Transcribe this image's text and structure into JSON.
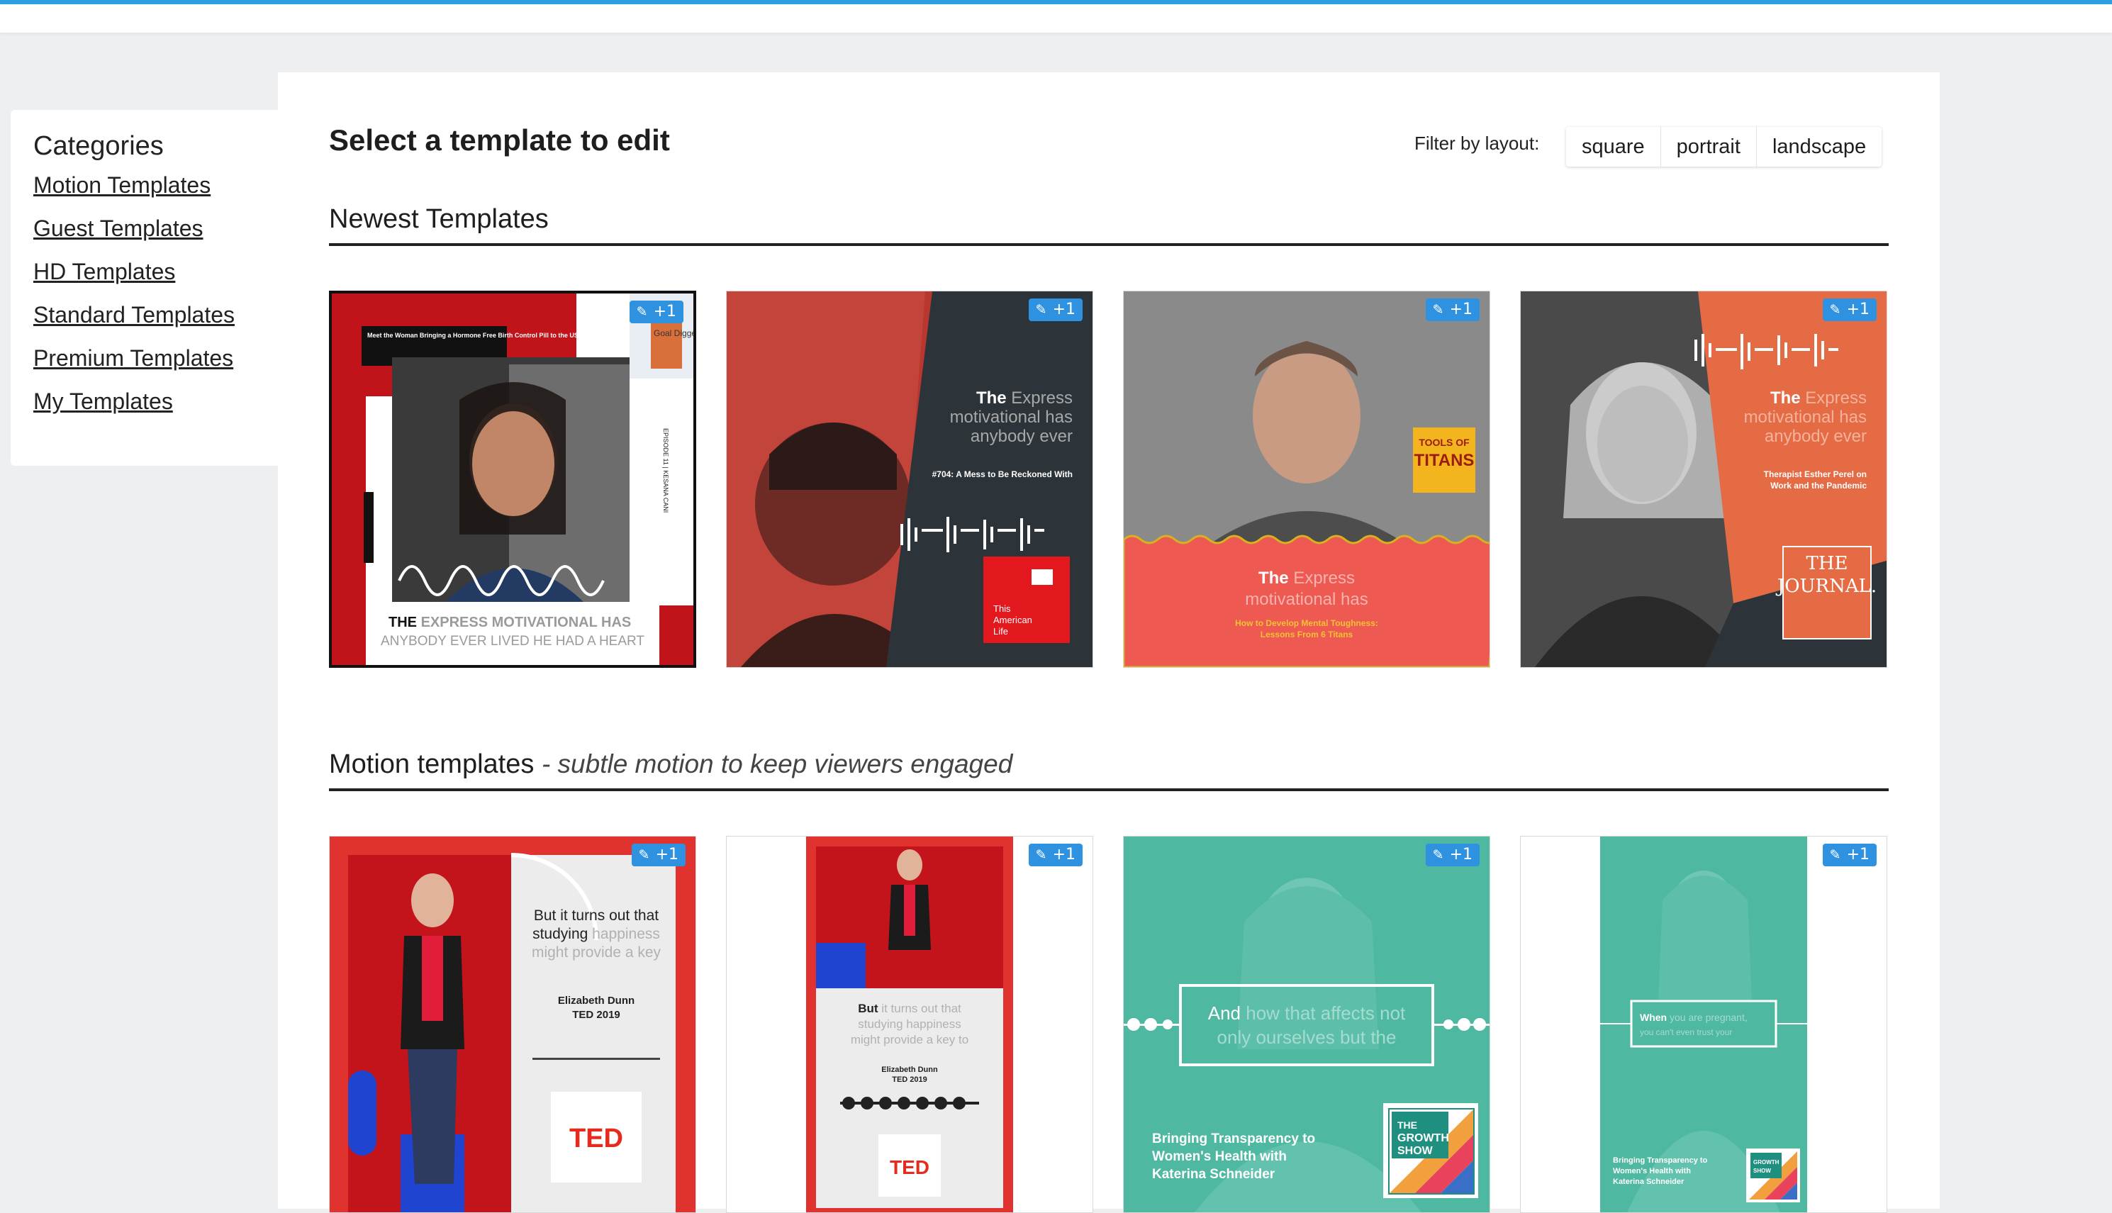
{
  "sidebar": {
    "heading": "Categories",
    "links": [
      "Motion Templates",
      "Guest Templates",
      "HD Templates",
      "Standard Templates",
      "Premium Templates",
      "My Templates"
    ]
  },
  "header": {
    "title": "Select a template to edit",
    "filter_label": "Filter by layout:",
    "filters": [
      "square",
      "portrait",
      "landscape"
    ]
  },
  "sections": {
    "newest": {
      "title": "Newest Templates"
    },
    "motion": {
      "title": "Motion templates",
      "subtitle": "- subtle motion to keep viewers engaged"
    }
  },
  "badge_label": "+1",
  "cards": {
    "c1": {
      "top_text": "Meet the Woman Bringing a Hormone Free Birth Control Pill to the US Market",
      "logo_text": "Goal Digger",
      "side_text": "EPISODE 11 | KESANA CANI",
      "caption_bold": "THE",
      "caption_rest": "EXPRESS MOTIVATIONAL HAS",
      "caption_line2": "ANYBODY EVER LIVED HE HAD A HEART"
    },
    "c2": {
      "headline_bold": "The",
      "headline_rest": "Express",
      "line2": "motivational has",
      "line3": "anybody ever",
      "episode": "#704: A Mess to Be Reckoned With",
      "logo_line1": "This",
      "logo_line2": "American",
      "logo_line3": "Life"
    },
    "c3": {
      "logo_line1": "TOOLS OF",
      "logo_line2": "TITANS",
      "headline_bold": "The",
      "headline_rest": "Express",
      "line2": "motivational has",
      "sub1": "How to Develop Mental Toughness:",
      "sub2": "Lessons From 6 Titans"
    },
    "c4": {
      "headline_bold": "The",
      "headline_rest": "Express",
      "line2": "motivational has",
      "line3": "anybody ever",
      "sub1": "Therapist Esther Perel on",
      "sub2": "Work and the Pandemic",
      "logo_line1": "THE",
      "logo_line2": "JOURNAL."
    },
    "c5": {
      "line1": "But it turns out that",
      "line2_bold": "studying",
      "line2_rest": "happiness",
      "line3": "might provide a key",
      "speaker": "Elizabeth Dunn",
      "event": "TED 2019",
      "logo": "TED"
    },
    "c6": {
      "line1_bold": "But",
      "line1_rest": "it turns out that",
      "line2": "studying happiness",
      "line3": "might provide a key to",
      "speaker": "Elizabeth Dunn",
      "event": "TED 2019",
      "logo": "TED"
    },
    "c7": {
      "quote_bold": "And",
      "quote_rest": "how that affects not",
      "quote_line2": "only ourselves but the",
      "title1": "Bringing Transparency to",
      "title2": "Women's Health with",
      "title3": "Katerina Schneider",
      "logo_line1": "THE",
      "logo_line2": "GROWTH",
      "logo_line3": "SHOW"
    },
    "c8": {
      "quote_bold": "When",
      "quote_rest": "you are pregnant,",
      "quote_line2": "you can't even trust your",
      "title1": "Bringing Transparency to",
      "title2": "Women's Health with",
      "title3": "Katerina Schneider",
      "logo_line1": "GROWTH",
      "logo_line2": "SHOW"
    }
  },
  "colors": {
    "accent": "#2f9fe3",
    "ted_red": "#e0322e",
    "tools_red": "#ee5a52",
    "journal_orange": "#e56b45",
    "growth_teal": "#4fb8a1",
    "dark_slate": "#2c3439"
  }
}
